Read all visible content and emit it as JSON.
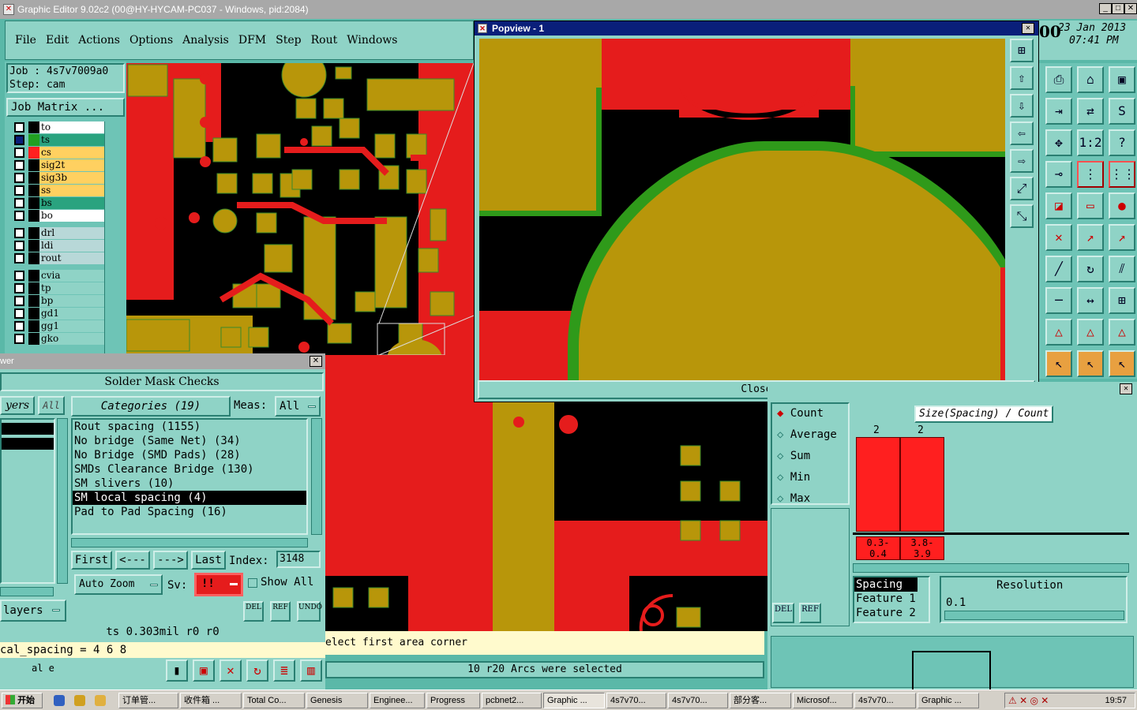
{
  "app": {
    "title": "Graphic Editor 9.02c2 (00@HY-HYCAM-PC037 - Windows, pid:2084)"
  },
  "menu": [
    "File",
    "Edit",
    "Actions",
    "Options",
    "Analysis",
    "DFM",
    "Step",
    "Rout",
    "Windows"
  ],
  "job": {
    "job_line": "Job : 4s7v7009a0",
    "step_line": "Step: cam",
    "matrix_button": "Job Matrix ..."
  },
  "layers": [
    {
      "name": "to",
      "color": "#ffffff",
      "swatch": "#000000"
    },
    {
      "name": "ts",
      "color": "#2aa37f",
      "swatch": "#22a022"
    },
    {
      "name": "cs",
      "color": "#ffd060",
      "swatch": "#ff2020"
    },
    {
      "name": "sig2t",
      "color": "#ffd060",
      "swatch": "#000000"
    },
    {
      "name": "sig3b",
      "color": "#ffd060",
      "swatch": "#000000"
    },
    {
      "name": "ss",
      "color": "#ffd060",
      "swatch": "#000000"
    },
    {
      "name": "bs",
      "color": "#2aa37f",
      "swatch": "#000000"
    },
    {
      "name": "bo",
      "color": "#ffffff",
      "swatch": "#000000"
    },
    {
      "name": "drl",
      "color": "#b8d8d8",
      "swatch": "#000000"
    },
    {
      "name": "ldi",
      "color": "#b8d8d8",
      "swatch": "#000000"
    },
    {
      "name": "rout",
      "color": "#b8d8d8",
      "swatch": "#000000"
    },
    {
      "name": "cvia",
      "color": "#8fd3c6",
      "swatch": "#000000"
    },
    {
      "name": "tp",
      "color": "#8fd3c6",
      "swatch": "#000000"
    },
    {
      "name": "bp",
      "color": "#8fd3c6",
      "swatch": "#000000"
    },
    {
      "name": "gd1",
      "color": "#8fd3c6",
      "swatch": "#000000"
    },
    {
      "name": "gg1",
      "color": "#8fd3c6",
      "swatch": "#000000"
    },
    {
      "name": "gko",
      "color": "#8fd3c6",
      "swatch": "#000000"
    }
  ],
  "popview": {
    "title": "Popview - 1",
    "close_label": "Close"
  },
  "clock": {
    "date": "23 Jan 2013",
    "time": "07:41 PM",
    "prefix": "00"
  },
  "solder": {
    "window_title_fragment": "wer",
    "heading": "Solder Mask Checks",
    "layers_tab": "yers",
    "all_tab": "All",
    "categories_label": "Categories (19)",
    "meas_label": "Meas:",
    "meas_value": "All",
    "categories": [
      "Rout spacing (1155)",
      "No bridge (Same Net) (34)",
      "No Bridge (SMD Pads) (28)",
      "SMDs Clearance Bridge (130)",
      "SM slivers (10)",
      "SM local spacing (4)",
      "Pad to Pad Spacing (16)"
    ],
    "selected_index": 5,
    "first": "First",
    "prev": "<---",
    "next": "--->",
    "last": "Last",
    "index_label": "Index:",
    "index_value": "3148",
    "auto_zoom": "Auto Zoom",
    "sv_label": "Sv:",
    "sv_value": "!!",
    "show_all": "Show All",
    "layers_btn": "layers",
    "del": "DEL",
    "ref": "REF",
    "undo": "UNDO",
    "status_line": "ts 0.303mil  r0  r0",
    "formula": "cal_spacing = 4 6 8",
    "bottom_fragment": "al e"
  },
  "status": {
    "prompt": "elect first area corner",
    "message": "10 r20 Arcs were selected"
  },
  "histogram": {
    "options": [
      "Count",
      "Average",
      "Sum",
      "Min",
      "Max"
    ],
    "selected": "Count",
    "title": "Size(Spacing) / Count",
    "del": "DEL",
    "ref": "REF",
    "bars": [
      {
        "count": "2",
        "label": "0.3-\n0.4",
        "value": 2
      },
      {
        "count": "2",
        "label": "3.8-\n3.9",
        "value": 2
      }
    ],
    "list": [
      "Spacing",
      "Feature 1",
      "Feature 2"
    ],
    "resolution_label": "Resolution",
    "resolution_value": "0.1"
  },
  "taskbar": {
    "start": "开始",
    "tasks": [
      "订单管...",
      "收件箱 ...",
      "Total Co...",
      "Genesis",
      "Enginee...",
      "Progress",
      "pcbnet2...",
      "Graphic ...",
      "4s7v70...",
      "4s7v70...",
      "部分客...",
      "Microsof...",
      "4s7v70...",
      "Graphic ..."
    ],
    "clock": "19:57"
  }
}
